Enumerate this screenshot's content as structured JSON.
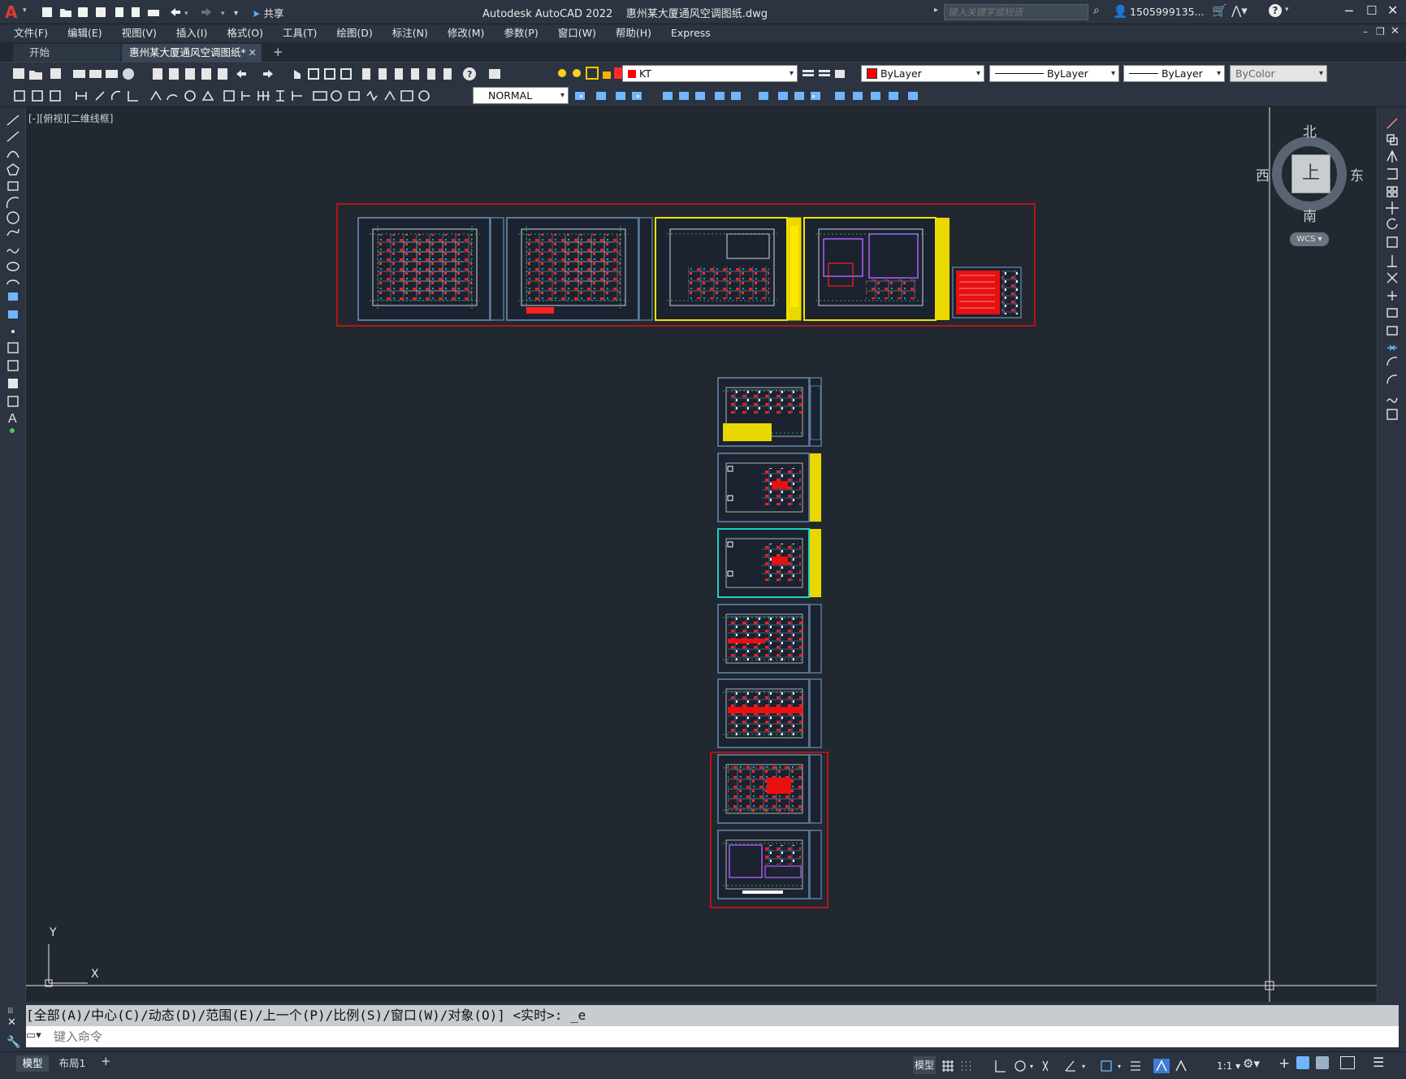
{
  "title_bar": {
    "app_title": "Autodesk AutoCAD 2022",
    "file_name": "惠州某大厦通风空调图纸.dwg",
    "share_label": "共享",
    "search_placeholder": "键入关键字或短语",
    "user_name": "1505999135..."
  },
  "menu": [
    "文件(F)",
    "编辑(E)",
    "视图(V)",
    "插入(I)",
    "格式(O)",
    "工具(T)",
    "绘图(D)",
    "标注(N)",
    "修改(M)",
    "参数(P)",
    "窗口(W)",
    "帮助(H)",
    "Express"
  ],
  "tabs": {
    "start": "开始",
    "active": "惠州某大厦通风空调图纸*"
  },
  "layer": {
    "name": "KT",
    "color": "#ff0000"
  },
  "properties": {
    "color": "ByLayer",
    "linetype": "ByLayer",
    "lineweight": "ByLayer",
    "plotstyle": "ByColor"
  },
  "dimstyle": "NORMAL",
  "viewport_label": "[-][俯视][二维线框]",
  "viewcube": {
    "north": "北",
    "south": "南",
    "east": "东",
    "west": "西",
    "face": "上",
    "wcs": "WCS"
  },
  "ucs": {
    "x": "X",
    "y": "Y"
  },
  "command": {
    "history": "[全部(A)/中心(C)/动态(D)/范围(E)/上一个(P)/比例(S)/窗口(W)/对象(O)] <实时>: _e",
    "placeholder": "键入命令"
  },
  "layout_tabs": [
    "模型",
    "布局1"
  ],
  "status": {
    "model": "模型",
    "scale": "1:1"
  }
}
